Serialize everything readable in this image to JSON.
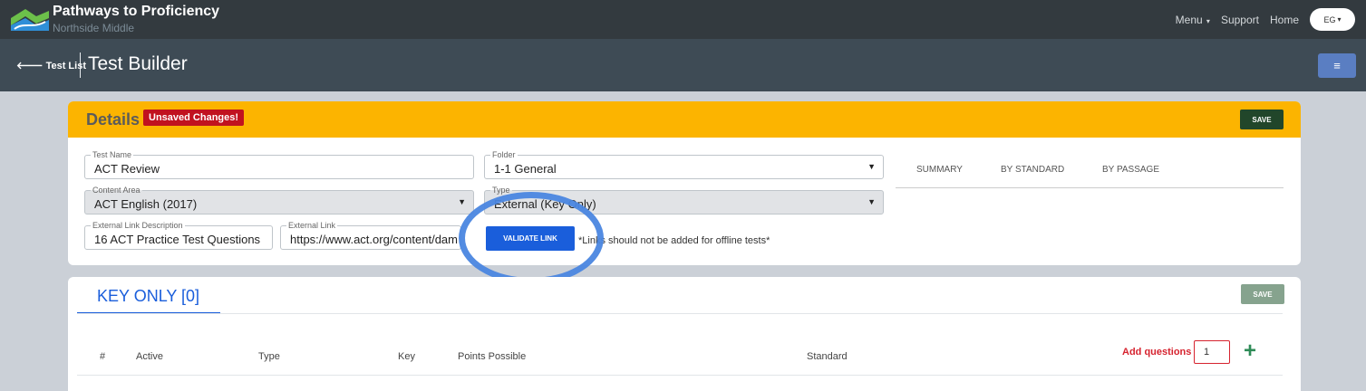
{
  "app": {
    "title": "Pathways to Proficiency",
    "subtitle": "Northside Middle"
  },
  "nav": {
    "menu_label": "Menu",
    "support_label": "Support",
    "home_label": "Home",
    "user_initials": "EG"
  },
  "subbar": {
    "back_label": "Test List",
    "page_title": "Test Builder"
  },
  "details": {
    "title": "Details",
    "badge": "Unsaved Changes!",
    "save_label": "SAVE",
    "test_name": {
      "label": "Test Name",
      "value": "ACT Review"
    },
    "folder": {
      "label": "Folder",
      "value": "1-1 General"
    },
    "content_area": {
      "label": "Content Area",
      "value": "ACT English (2017)"
    },
    "type": {
      "label": "Type",
      "value": "External (Key Only)"
    },
    "ext_desc": {
      "label": "External Link Description",
      "value": "16 ACT Practice Test Questions"
    },
    "ext_link": {
      "label": "External Link",
      "value": "https://www.act.org/content/dam/act"
    },
    "validate_label": "VALIDATE LINK",
    "note": "*Links should not be added for offline tests*",
    "tabs": [
      "SUMMARY",
      "BY STANDARD",
      "BY PASSAGE"
    ]
  },
  "key_only": {
    "tab_label": "KEY ONLY [0]",
    "save_label": "SAVE",
    "columns": [
      "#",
      "Active",
      "Type",
      "Key",
      "Points Possible",
      "Standard"
    ],
    "add_questions_label": "Add questions",
    "add_questions_value": "1"
  },
  "colors": {
    "accent": "#fcb400",
    "primary": "#1a5edb",
    "danger": "#c1121f",
    "highlight_circle": "#4a86e0"
  }
}
